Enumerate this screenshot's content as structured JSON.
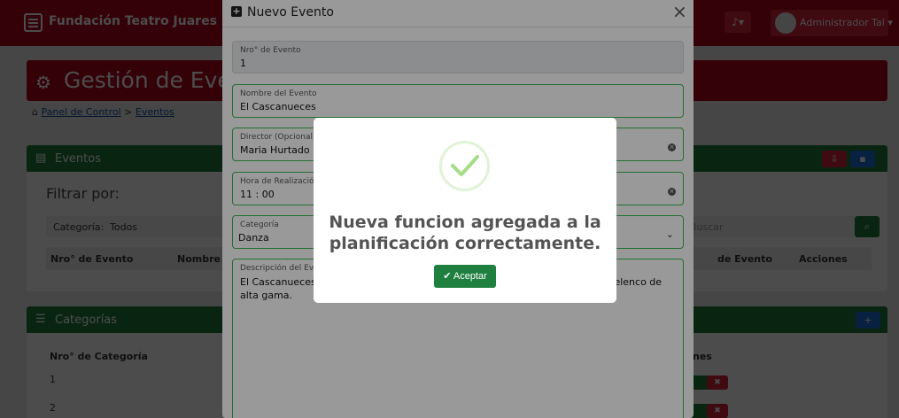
{
  "app": {
    "brand": "Fundación Teatro Juares",
    "bell_icon": "bell-icon",
    "user": "Administrador Tal",
    "page_title": "Gestión de Eventos",
    "breadcrumb": [
      "Panel de Control",
      "Eventos"
    ]
  },
  "events_panel": {
    "title": "Eventos",
    "filter_label": "Filtrar por:",
    "filter_category_label": "Categoría:",
    "filter_category_value": "Todos",
    "search_placeholder": "Buscar",
    "columns": [
      "Nro° de Evento",
      "Nombre",
      "de Evento",
      "Acciones"
    ]
  },
  "categories_panel": {
    "title": "Categorías",
    "columns": [
      "Nro° de Categoría",
      "nes"
    ],
    "rows": [
      "1",
      "2"
    ]
  },
  "modal": {
    "title": "Nuevo Evento",
    "fields": {
      "nro_label": "Nro° de Evento",
      "nro_value": "1",
      "nombre_label": "Nombre del Evento",
      "nombre_value": "El Cascanueces",
      "director_label": "Director (Opcional)",
      "director_value": "Maria Hurtado",
      "hora_label": "Hora de Realización",
      "hora_value": "11 : 00",
      "categoria_label": "Categoría",
      "categoria_value": "Danza",
      "descripcion_label": "Descripción del Evento",
      "descripcion_value_start": "El Cascanueces es",
      "descripcion_value_end": "n elenco de",
      "descripcion_value_line2": "alta gama."
    }
  },
  "alert": {
    "message": "Nueva funcion agregada a la planificación correctamente.",
    "button": "Aceptar",
    "icon": "success-check-icon",
    "accent": "#a5dc86"
  },
  "colors": {
    "brand_red": "#b0071c",
    "panel_green": "#1e7f3e",
    "field_border": "#3db853"
  }
}
